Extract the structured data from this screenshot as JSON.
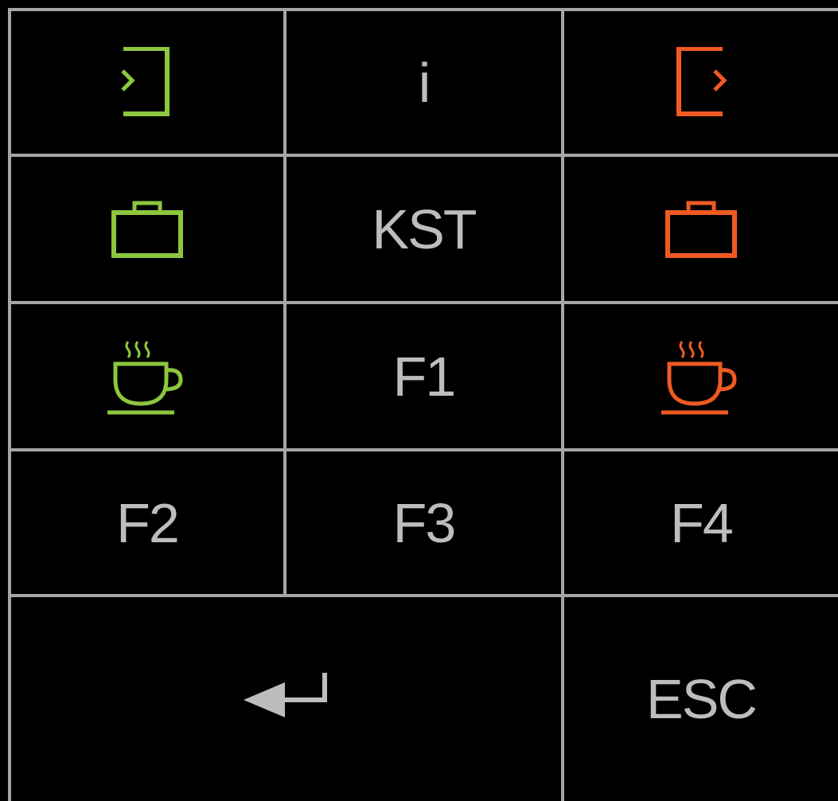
{
  "colors": {
    "background": "#000000",
    "grid": "#a6a6a6",
    "text": "#bdbdbd",
    "accent_in": "#8dc63f",
    "accent_out": "#f05a22"
  },
  "keys": {
    "check_in": {
      "icon": "login-arrow-icon"
    },
    "info": {
      "label": "i"
    },
    "check_out": {
      "icon": "logout-arrow-icon"
    },
    "business_in": {
      "icon": "briefcase-icon"
    },
    "kst": {
      "label": "KST"
    },
    "business_out": {
      "icon": "briefcase-icon"
    },
    "break_in": {
      "icon": "coffee-cup-icon"
    },
    "f1": {
      "label": "F1"
    },
    "break_out": {
      "icon": "coffee-cup-icon"
    },
    "f2": {
      "label": "F2"
    },
    "f3": {
      "label": "F3"
    },
    "f4": {
      "label": "F4"
    },
    "enter": {
      "icon": "enter-arrow-icon"
    },
    "esc": {
      "label": "ESC"
    }
  }
}
